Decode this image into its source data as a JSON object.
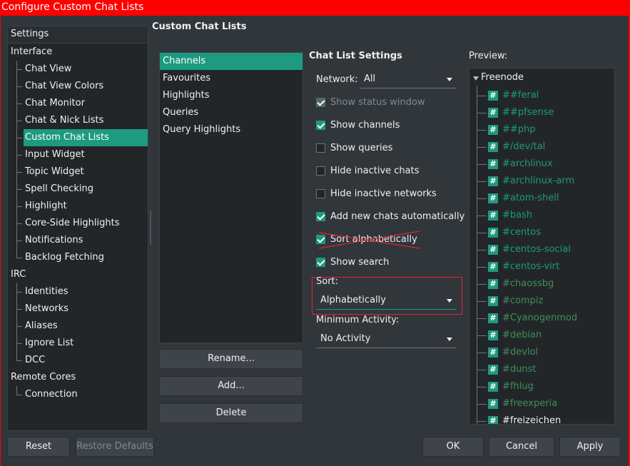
{
  "window": {
    "title": "Configure Custom Chat Lists"
  },
  "sidebar": {
    "header": "Settings",
    "groups": [
      {
        "label": "Interface",
        "items": [
          "Chat View",
          "Chat View Colors",
          "Chat Monitor",
          "Chat & Nick Lists",
          "Custom Chat Lists",
          "Input Widget",
          "Topic Widget",
          "Spell Checking",
          "Highlight",
          "Core-Side Highlights",
          "Notifications",
          "Backlog Fetching"
        ]
      },
      {
        "label": "IRC",
        "items": [
          "Identities",
          "Networks",
          "Aliases",
          "Ignore List",
          "DCC"
        ]
      },
      {
        "label": "Remote Cores",
        "items": [
          "Connection"
        ]
      }
    ],
    "selected": "Custom Chat Lists"
  },
  "page": {
    "title": "Custom Chat Lists"
  },
  "chat_lists": {
    "items": [
      "Channels",
      "Favourites",
      "Highlights",
      "Queries",
      "Query Highlights"
    ],
    "selected": "Channels",
    "rename_label": "Rename...",
    "add_label": "Add...",
    "delete_label": "Delete"
  },
  "settings": {
    "title": "Chat List Settings",
    "network_label": "Network:",
    "network_value": "All",
    "options": [
      {
        "label": "Show status window",
        "checked": true,
        "disabled": true
      },
      {
        "label": "Show channels",
        "checked": true,
        "disabled": false
      },
      {
        "label": "Show queries",
        "checked": false,
        "disabled": false
      },
      {
        "label": "Hide inactive chats",
        "checked": false,
        "disabled": false
      },
      {
        "label": "Hide inactive networks",
        "checked": false,
        "disabled": false
      },
      {
        "label": "Add new chats automatically",
        "checked": true,
        "disabled": false
      },
      {
        "label": "Sort alphabetically",
        "checked": true,
        "disabled": false
      },
      {
        "label": "Show search",
        "checked": true,
        "disabled": false
      }
    ],
    "sort_label": "Sort:",
    "sort_value": "Alphabetically",
    "min_activity_label": "Minimum Activity:",
    "min_activity_value": "No Activity"
  },
  "preview": {
    "label": "Preview:",
    "network": "Freenode",
    "channels": [
      "##feral",
      "##pfsense",
      "##php",
      "#/dev/tal",
      "#archlinux",
      "#archlinux-arm",
      "#atom-shell",
      "#bash",
      "#centos",
      "#centos-social",
      "#centos-virt",
      "#chaossbg",
      "#compiz",
      "#Cyanogenmod",
      "#debian",
      "#devlol",
      "#dunst",
      "#fhlug",
      "#freexperia",
      "#freizeichen"
    ],
    "hash_glyph": "#"
  },
  "footer": {
    "reset_label": "Reset",
    "restore_label": "Restore Defaults",
    "ok_label": "OK",
    "cancel_label": "Cancel",
    "apply_label": "Apply"
  },
  "colors": {
    "accent": "#1d9a7f",
    "highlight_box": "#e0262c",
    "titlebar": "#ff0000"
  }
}
